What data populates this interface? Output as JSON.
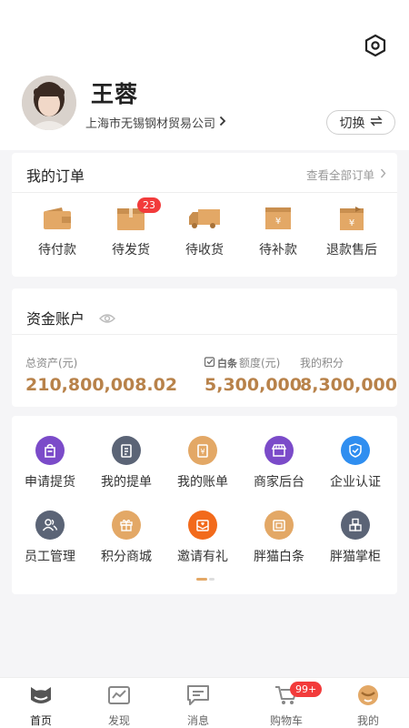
{
  "profile": {
    "name": "王蓉",
    "company": "上海市无锡钢材贸易公司",
    "switch_label": "切换"
  },
  "orders": {
    "title": "我的订单",
    "view_all": "查看全部订单",
    "items": [
      {
        "label": "待付款",
        "icon": "wallet-icon"
      },
      {
        "label": "待发货",
        "icon": "box-icon",
        "badge": "23"
      },
      {
        "label": "待收货",
        "icon": "truck-icon"
      },
      {
        "label": "待补款",
        "icon": "yuan-box-icon"
      },
      {
        "label": "退款售后",
        "icon": "refund-box-icon"
      }
    ]
  },
  "funds": {
    "title": "资金账户",
    "total_label": "总资产(元)",
    "total_value": "210,800,008.02",
    "credit_brand": "白条",
    "credit_label": "额度(元)",
    "credit_value": "5,300,000",
    "points_label": "我的积分",
    "points_value": "8,300,000"
  },
  "services": [
    {
      "label": "申请提货",
      "icon": "bag-icon",
      "color": "#7b4bc9"
    },
    {
      "label": "我的提单",
      "icon": "document-icon",
      "color": "#5b6476"
    },
    {
      "label": "我的账单",
      "icon": "bill-icon",
      "color": "#e3a866"
    },
    {
      "label": "商家后台",
      "icon": "store-icon",
      "color": "#7b4bc9"
    },
    {
      "label": "企业认证",
      "icon": "shield-check-icon",
      "color": "#2f8ef0"
    },
    {
      "label": "员工管理",
      "icon": "users-icon",
      "color": "#5b6476"
    },
    {
      "label": "积分商城",
      "icon": "gift-icon",
      "color": "#e3a866"
    },
    {
      "label": "邀请有礼",
      "icon": "mail-heart-icon",
      "color": "#f26a1b"
    },
    {
      "label": "胖猫白条",
      "icon": "credit-icon",
      "color": "#e3a866"
    },
    {
      "label": "胖猫掌柜",
      "icon": "cabinet-icon",
      "color": "#5b6476"
    }
  ],
  "tabbar": [
    {
      "label": "首页",
      "icon": "cat-home-icon",
      "active": true
    },
    {
      "label": "发现",
      "icon": "discover-icon"
    },
    {
      "label": "消息",
      "icon": "message-icon"
    },
    {
      "label": "购物车",
      "icon": "cart-icon",
      "badge": "99+"
    },
    {
      "label": "我的",
      "icon": "profile-icon"
    }
  ],
  "colors": {
    "accent_gold": "#b8824a",
    "icon_gold": "#e3a866",
    "badge_red": "#f23b3b"
  }
}
